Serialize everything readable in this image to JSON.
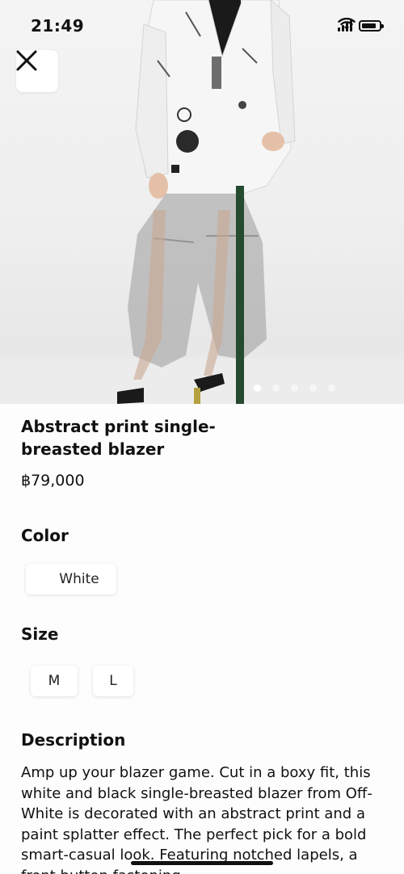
{
  "status_bar": {
    "time": "21:49"
  },
  "gallery": {
    "image_count": 5,
    "active_index": 0
  },
  "product": {
    "title": "Abstract print single-breasted blazer",
    "price": "฿79,000"
  },
  "color": {
    "heading": "Color",
    "options": [
      "White"
    ]
  },
  "size": {
    "heading": "Size",
    "options": [
      "M",
      "L"
    ]
  },
  "description": {
    "heading": "Description",
    "text": "Amp up your blazer game. Cut in a boxy fit, this white and black single-breasted blazer from Off-White is decorated with an abstract print and a paint splatter effect. The perfect pick for a bold smart-casual look. Featuring notched lapels, a front button fastening"
  },
  "colors": {
    "background": "#fdfdfd",
    "text": "#111111",
    "chip": "#ffffff"
  }
}
